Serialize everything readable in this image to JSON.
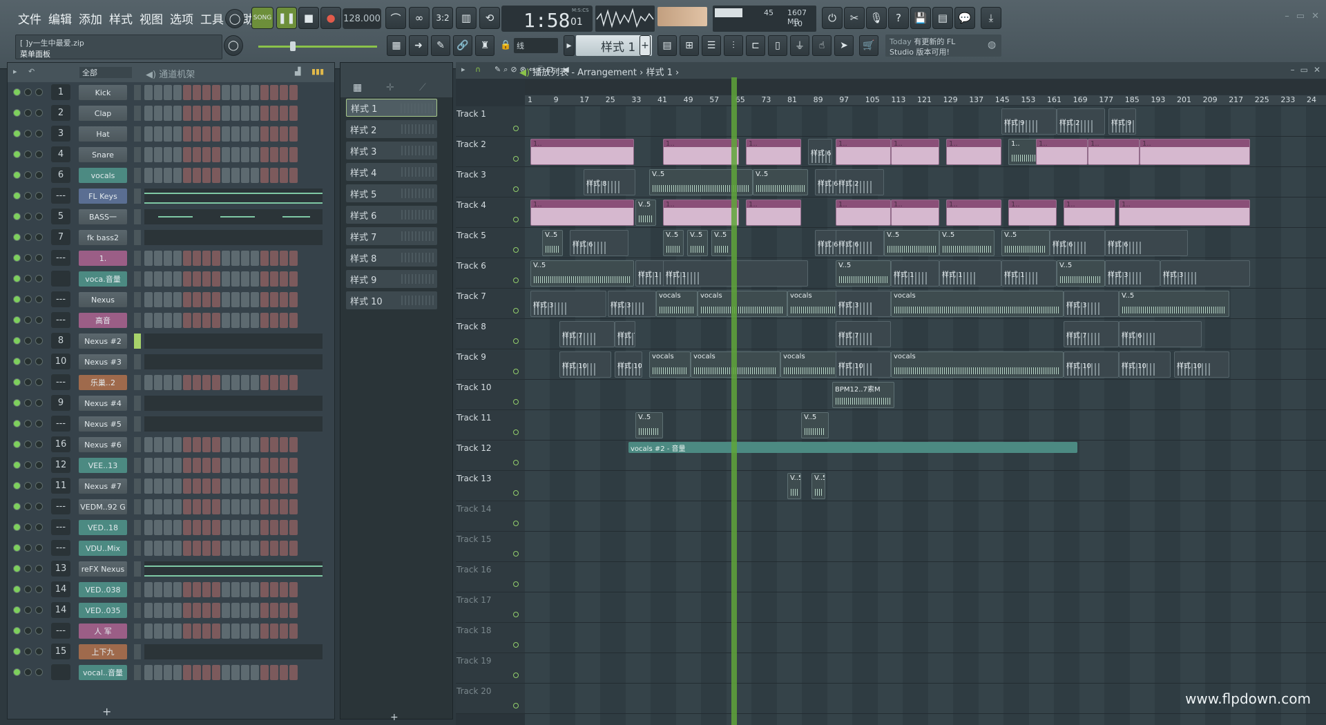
{
  "menu": [
    "文件",
    "编辑",
    "添加",
    "样式",
    "视图",
    "选项",
    "工具",
    "帮助"
  ],
  "hint": {
    "line1": "[ ]y一生中最爱.zip",
    "line2": "菜单面板"
  },
  "transport": {
    "mode": "SONG",
    "tempo": "128.000",
    "time": "1:58",
    "time_sub": "01",
    "time_unit": "M:S:CS"
  },
  "cpu": {
    "cpu": "45",
    "mem": "1607 MB",
    "poly": "10"
  },
  "pattern_select": "样式 1",
  "snap": "线",
  "news": {
    "today": "Today",
    "text1": "有更新的 FL",
    "text2": "Studio 版本可用!"
  },
  "rack": {
    "filter": "全部",
    "title": "通道机架",
    "channels": [
      {
        "num": "1",
        "name": "Kick",
        "kind": "steps"
      },
      {
        "num": "2",
        "name": "Clap",
        "kind": "steps"
      },
      {
        "num": "3",
        "name": "Hat",
        "kind": "steps"
      },
      {
        "num": "4",
        "name": "Snare",
        "kind": "steps"
      },
      {
        "num": "6",
        "name": "vocals",
        "kind": "steps",
        "color": "teal"
      },
      {
        "num": "---",
        "name": "FL Keys",
        "kind": "keys",
        "color": "blue"
      },
      {
        "num": "5",
        "name": "BASS一",
        "kind": "dash"
      },
      {
        "num": "7",
        "name": "fk bass2",
        "kind": "roll"
      },
      {
        "num": "---",
        "name": "1.",
        "kind": "steps",
        "color": "pink"
      },
      {
        "num": "",
        "name": "voca.音量",
        "kind": "steps",
        "color": "teal"
      },
      {
        "num": "---",
        "name": "Nexus",
        "kind": "steps"
      },
      {
        "num": "---",
        "name": "高音",
        "kind": "steps",
        "color": "pink"
      },
      {
        "num": "8",
        "name": "Nexus #2",
        "kind": "roll"
      },
      {
        "num": "10",
        "name": "Nexus #3",
        "kind": "roll"
      },
      {
        "num": "---",
        "name": "乐巢..2",
        "kind": "steps",
        "color": "orange"
      },
      {
        "num": "9",
        "name": "Nexus #4",
        "kind": "roll"
      },
      {
        "num": "---",
        "name": "Nexus #5",
        "kind": "roll"
      },
      {
        "num": "16",
        "name": "Nexus #6",
        "kind": "steps"
      },
      {
        "num": "12",
        "name": "VEE..13",
        "kind": "steps",
        "color": "teal"
      },
      {
        "num": "11",
        "name": "Nexus #7",
        "kind": "steps"
      },
      {
        "num": "---",
        "name": "VEDM..92 G",
        "kind": "steps"
      },
      {
        "num": "---",
        "name": "VED..18",
        "kind": "steps",
        "color": "teal"
      },
      {
        "num": "---",
        "name": "VDU..Mix",
        "kind": "steps",
        "color": "teal"
      },
      {
        "num": "13",
        "name": "reFX Nexus",
        "kind": "keys"
      },
      {
        "num": "14",
        "name": "VED..038",
        "kind": "steps",
        "color": "teal"
      },
      {
        "num": "14",
        "name": "VED..035",
        "kind": "steps",
        "color": "teal"
      },
      {
        "num": "---",
        "name": "人 军",
        "kind": "steps",
        "color": "pink"
      },
      {
        "num": "15",
        "name": "上下九",
        "kind": "roll",
        "color": "orange"
      },
      {
        "num": "",
        "name": "vocal..音量",
        "kind": "steps",
        "color": "teal"
      }
    ]
  },
  "patterns": [
    "样式 1",
    "样式 2",
    "样式 3",
    "样式 4",
    "样式 5",
    "样式 6",
    "样式 7",
    "样式 8",
    "样式 9",
    "样式 10"
  ],
  "playlist": {
    "title": "播放列表 - Arrangement",
    "pattern": "样式 1",
    "ruler": [
      "1",
      "9",
      "17",
      "25",
      "33",
      "41",
      "49",
      "57",
      "65",
      "73",
      "81",
      "89",
      "97",
      "105",
      "113",
      "121",
      "129",
      "137",
      "145",
      "153",
      "161",
      "169",
      "177",
      "185",
      "193",
      "201",
      "209",
      "217",
      "225",
      "233",
      "24"
    ],
    "tracks": [
      "Track 1",
      "Track 2",
      "Track 3",
      "Track 4",
      "Track 5",
      "Track 6",
      "Track 7",
      "Track 8",
      "Track 9",
      "Track 10",
      "Track 11",
      "Track 12",
      "Track 13",
      "Track 14",
      "Track 15",
      "Track 16",
      "Track 17",
      "Track 18",
      "Track 19",
      "Track 20"
    ],
    "clip_labels": {
      "pat9": "样式 9",
      "pat2": "样式 2",
      "pat8": "样式 8",
      "pat6": "样式 6",
      "pat1": "样式 1",
      "pat3": "样式 3",
      "pat7": "样式 7",
      "pat10": "样式 10",
      "vocals": "vocals",
      "bpm": "BPM12..7索M",
      "auto": "vocals #2 - 音量",
      "v5": "V..5",
      "p1": "1.."
    }
  },
  "watermark": "www.flpdown.com"
}
